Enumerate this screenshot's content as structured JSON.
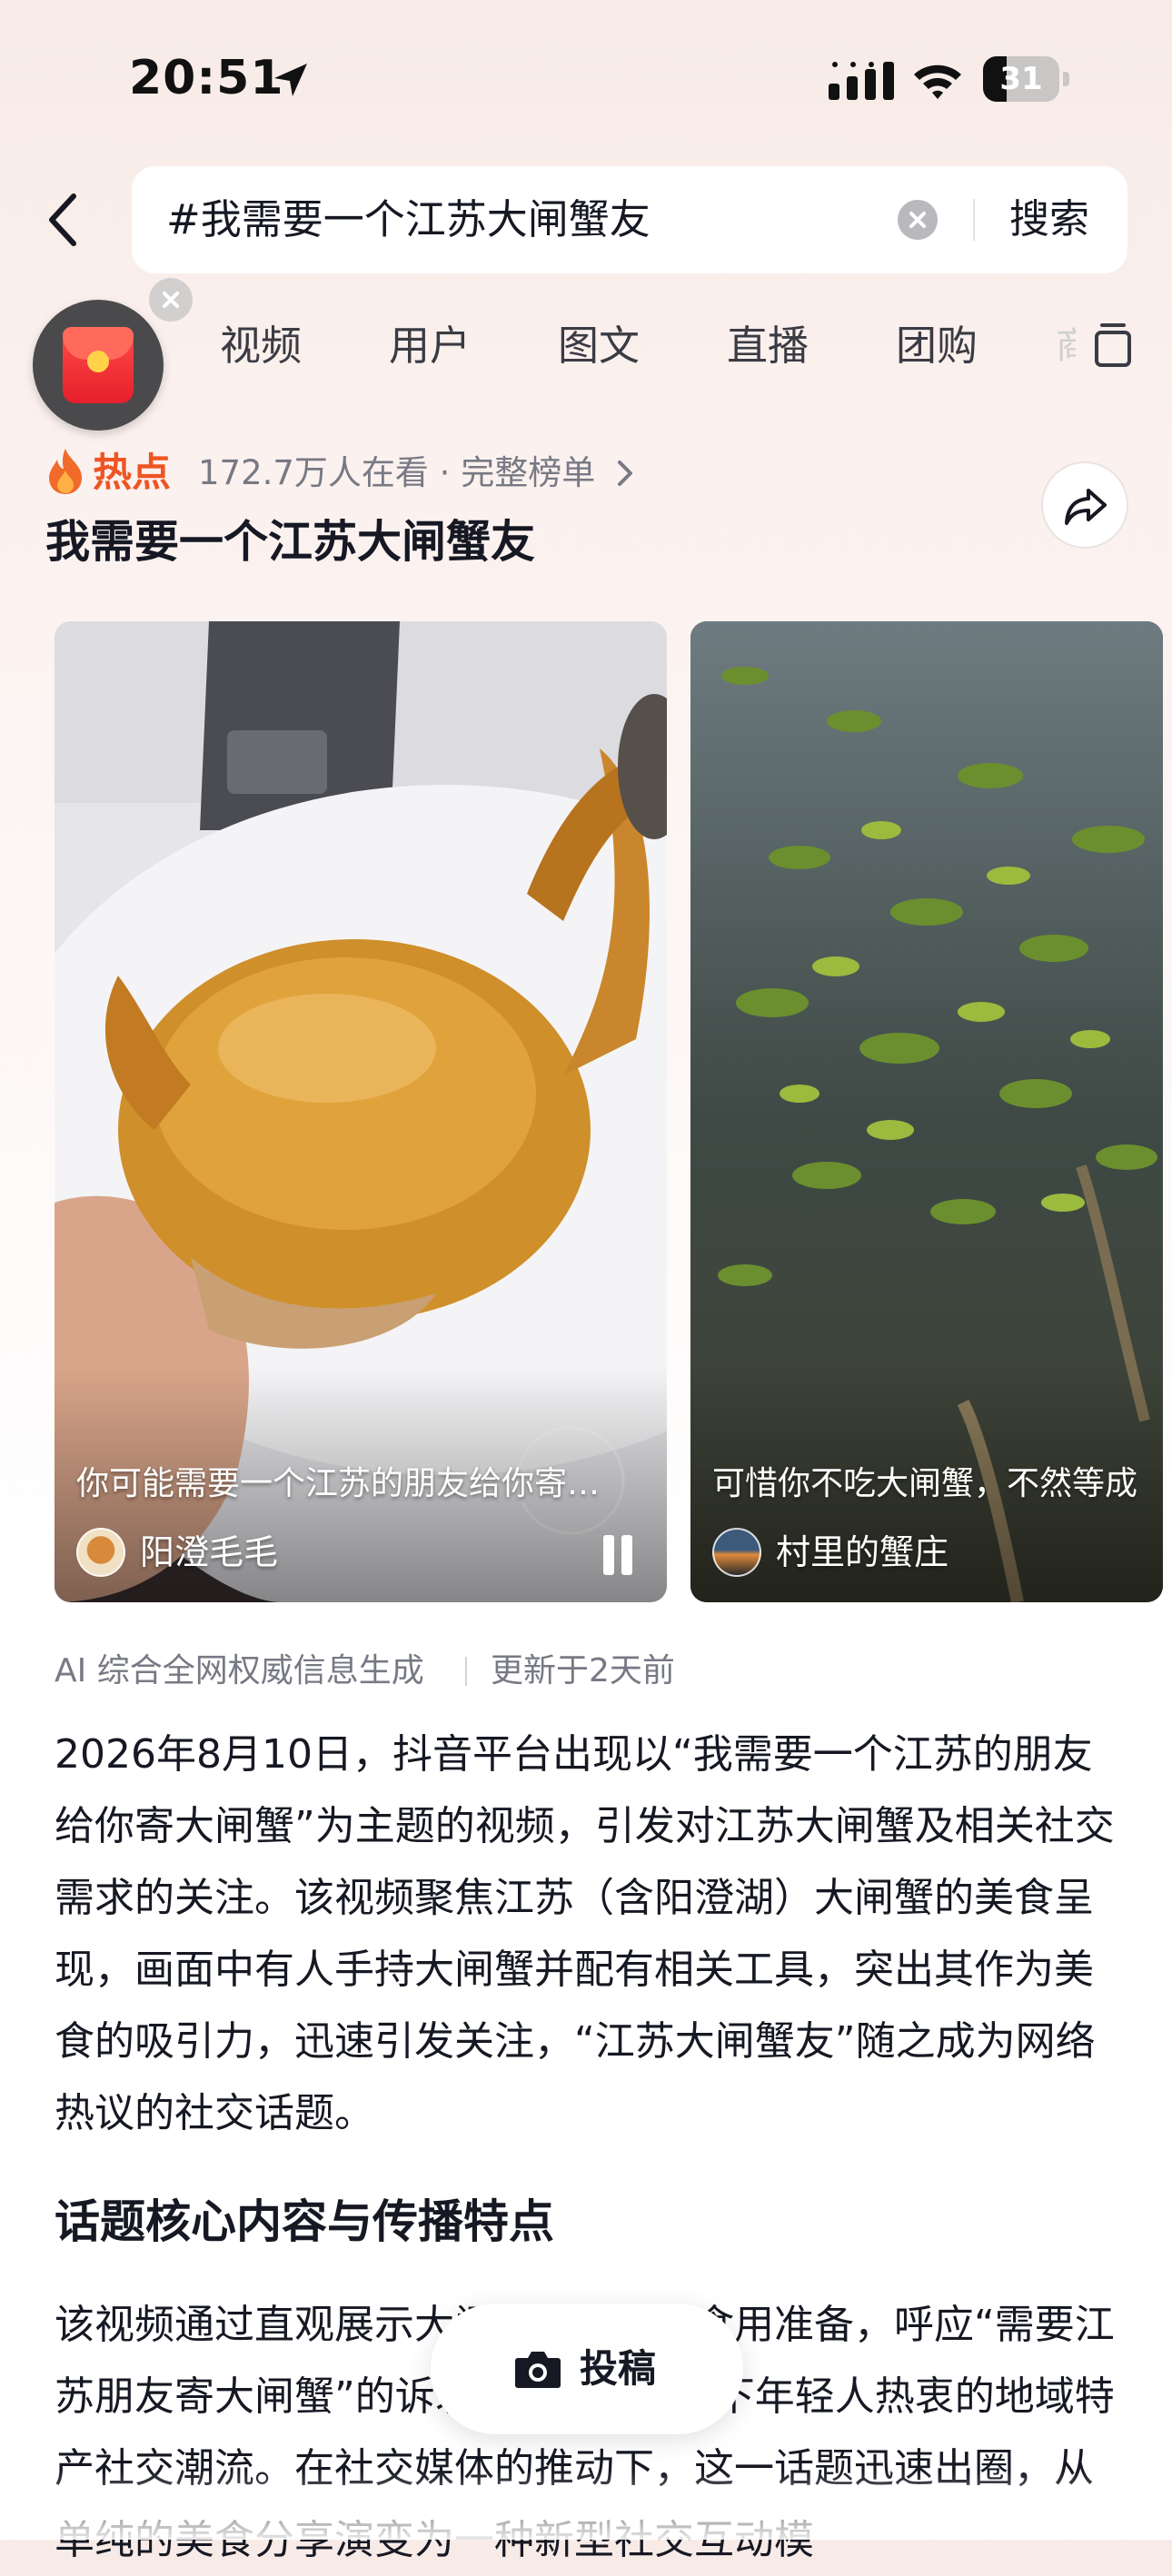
{
  "status_bar": {
    "time": "20:51",
    "battery": "31",
    "battery_level": 0.31
  },
  "search": {
    "query": "#我需要一个江苏大闸蟹友",
    "button_label": "搜索"
  },
  "tabs": [
    "视频",
    "用户",
    "图文",
    "直播",
    "团购",
    "商"
  ],
  "hot": {
    "label": "热点",
    "meta": "172.7万人在看 · 完整榜单",
    "title": "我需要一个江苏大闸蟹友"
  },
  "videos": [
    {
      "caption": "你可能需要一个江苏的朋友给你寄…",
      "author": "阳澄毛毛"
    },
    {
      "caption": "可惜你不吃大闸蟹，不然等成",
      "author": "村里的蟹庄"
    }
  ],
  "article": {
    "source": "AI 综合全网权威信息生成",
    "updated": "更新于2天前",
    "paragraph1": "2026年8月10日，抖音平台出现以“我需要一个江苏的朋友给你寄大闸蟹”为主题的视频，引发对江苏大闸蟹及相关社交需求的关注。该视频聚焦江苏（含阳澄湖）大闸蟹的美食呈现，画面中有人手持大闸蟹并配有相关工具，突出其作为美食的吸引力，迅速引发关注，“江苏大闸蟹友”随之成为网络热议的社交话题。",
    "section_title": "话题核心内容与传播特点",
    "paragraph2": "该视频通过直观展示大闸蟹的外观和食用准备，呼应“需要江苏朋友寄大闸蟹”的诉求，精准契合当下年轻人热衷的地域特产社交潮流。在社交媒体的推动下，这一话题迅速出圈，从单纯的美食分享演变为一种新型社交互动模"
  },
  "post_button": {
    "label": "投稿"
  },
  "colors": {
    "hot": "#ee5524",
    "redpacket": "#e61f2b",
    "text": "#161823",
    "muted": "#777984"
  }
}
